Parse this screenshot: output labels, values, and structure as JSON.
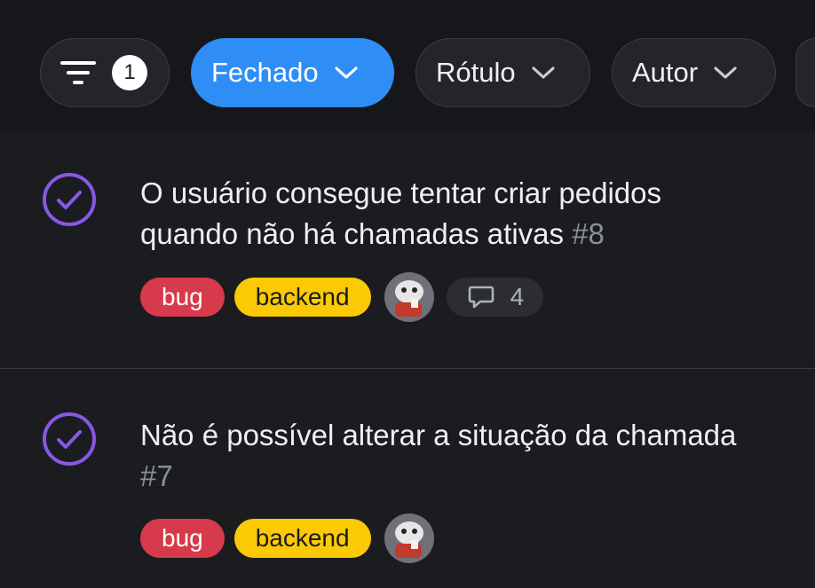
{
  "filters": {
    "count": "1",
    "state_label": "Fechado",
    "label_label": "Rótulo",
    "author_label": "Autor"
  },
  "issues": [
    {
      "title_line1": "O usuário consegue tentar criar pedidos",
      "title_line2": "quando não há chamadas ativas",
      "number": "#8",
      "labels": [
        "bug",
        "backend"
      ],
      "comments": "4"
    },
    {
      "title_line1": "Não é possível alterar a situação da chamada",
      "number": "#7",
      "labels": [
        "bug",
        "backend"
      ]
    }
  ],
  "colors": {
    "accent": "#2e8ef5",
    "closed_icon": "#8957e5",
    "bug": "#d73a4a",
    "backend": "#fbca04",
    "background": "#1b1c20"
  },
  "icons": [
    "filter-icon",
    "chevron-down-icon",
    "closed-issue-icon",
    "comment-icon"
  ]
}
